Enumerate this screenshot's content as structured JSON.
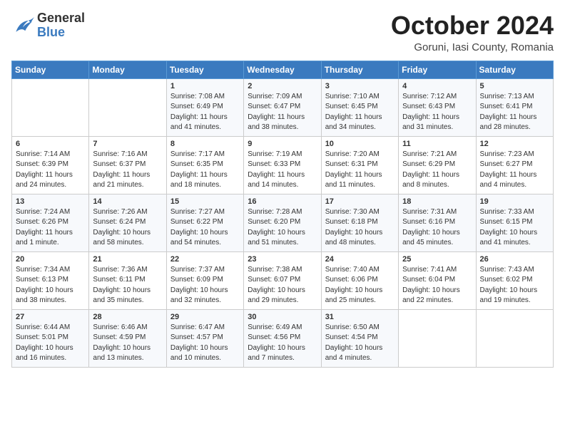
{
  "header": {
    "logo_general": "General",
    "logo_blue": "Blue",
    "month_title": "October 2024",
    "location": "Goruni, Iasi County, Romania"
  },
  "days_of_week": [
    "Sunday",
    "Monday",
    "Tuesday",
    "Wednesday",
    "Thursday",
    "Friday",
    "Saturday"
  ],
  "weeks": [
    [
      {
        "day": "",
        "info": ""
      },
      {
        "day": "",
        "info": ""
      },
      {
        "day": "1",
        "info": "Sunrise: 7:08 AM\nSunset: 6:49 PM\nDaylight: 11 hours and 41 minutes."
      },
      {
        "day": "2",
        "info": "Sunrise: 7:09 AM\nSunset: 6:47 PM\nDaylight: 11 hours and 38 minutes."
      },
      {
        "day": "3",
        "info": "Sunrise: 7:10 AM\nSunset: 6:45 PM\nDaylight: 11 hours and 34 minutes."
      },
      {
        "day": "4",
        "info": "Sunrise: 7:12 AM\nSunset: 6:43 PM\nDaylight: 11 hours and 31 minutes."
      },
      {
        "day": "5",
        "info": "Sunrise: 7:13 AM\nSunset: 6:41 PM\nDaylight: 11 hours and 28 minutes."
      }
    ],
    [
      {
        "day": "6",
        "info": "Sunrise: 7:14 AM\nSunset: 6:39 PM\nDaylight: 11 hours and 24 minutes."
      },
      {
        "day": "7",
        "info": "Sunrise: 7:16 AM\nSunset: 6:37 PM\nDaylight: 11 hours and 21 minutes."
      },
      {
        "day": "8",
        "info": "Sunrise: 7:17 AM\nSunset: 6:35 PM\nDaylight: 11 hours and 18 minutes."
      },
      {
        "day": "9",
        "info": "Sunrise: 7:19 AM\nSunset: 6:33 PM\nDaylight: 11 hours and 14 minutes."
      },
      {
        "day": "10",
        "info": "Sunrise: 7:20 AM\nSunset: 6:31 PM\nDaylight: 11 hours and 11 minutes."
      },
      {
        "day": "11",
        "info": "Sunrise: 7:21 AM\nSunset: 6:29 PM\nDaylight: 11 hours and 8 minutes."
      },
      {
        "day": "12",
        "info": "Sunrise: 7:23 AM\nSunset: 6:27 PM\nDaylight: 11 hours and 4 minutes."
      }
    ],
    [
      {
        "day": "13",
        "info": "Sunrise: 7:24 AM\nSunset: 6:26 PM\nDaylight: 11 hours and 1 minute."
      },
      {
        "day": "14",
        "info": "Sunrise: 7:26 AM\nSunset: 6:24 PM\nDaylight: 10 hours and 58 minutes."
      },
      {
        "day": "15",
        "info": "Sunrise: 7:27 AM\nSunset: 6:22 PM\nDaylight: 10 hours and 54 minutes."
      },
      {
        "day": "16",
        "info": "Sunrise: 7:28 AM\nSunset: 6:20 PM\nDaylight: 10 hours and 51 minutes."
      },
      {
        "day": "17",
        "info": "Sunrise: 7:30 AM\nSunset: 6:18 PM\nDaylight: 10 hours and 48 minutes."
      },
      {
        "day": "18",
        "info": "Sunrise: 7:31 AM\nSunset: 6:16 PM\nDaylight: 10 hours and 45 minutes."
      },
      {
        "day": "19",
        "info": "Sunrise: 7:33 AM\nSunset: 6:15 PM\nDaylight: 10 hours and 41 minutes."
      }
    ],
    [
      {
        "day": "20",
        "info": "Sunrise: 7:34 AM\nSunset: 6:13 PM\nDaylight: 10 hours and 38 minutes."
      },
      {
        "day": "21",
        "info": "Sunrise: 7:36 AM\nSunset: 6:11 PM\nDaylight: 10 hours and 35 minutes."
      },
      {
        "day": "22",
        "info": "Sunrise: 7:37 AM\nSunset: 6:09 PM\nDaylight: 10 hours and 32 minutes."
      },
      {
        "day": "23",
        "info": "Sunrise: 7:38 AM\nSunset: 6:07 PM\nDaylight: 10 hours and 29 minutes."
      },
      {
        "day": "24",
        "info": "Sunrise: 7:40 AM\nSunset: 6:06 PM\nDaylight: 10 hours and 25 minutes."
      },
      {
        "day": "25",
        "info": "Sunrise: 7:41 AM\nSunset: 6:04 PM\nDaylight: 10 hours and 22 minutes."
      },
      {
        "day": "26",
        "info": "Sunrise: 7:43 AM\nSunset: 6:02 PM\nDaylight: 10 hours and 19 minutes."
      }
    ],
    [
      {
        "day": "27",
        "info": "Sunrise: 6:44 AM\nSunset: 5:01 PM\nDaylight: 10 hours and 16 minutes."
      },
      {
        "day": "28",
        "info": "Sunrise: 6:46 AM\nSunset: 4:59 PM\nDaylight: 10 hours and 13 minutes."
      },
      {
        "day": "29",
        "info": "Sunrise: 6:47 AM\nSunset: 4:57 PM\nDaylight: 10 hours and 10 minutes."
      },
      {
        "day": "30",
        "info": "Sunrise: 6:49 AM\nSunset: 4:56 PM\nDaylight: 10 hours and 7 minutes."
      },
      {
        "day": "31",
        "info": "Sunrise: 6:50 AM\nSunset: 4:54 PM\nDaylight: 10 hours and 4 minutes."
      },
      {
        "day": "",
        "info": ""
      },
      {
        "day": "",
        "info": ""
      }
    ]
  ]
}
